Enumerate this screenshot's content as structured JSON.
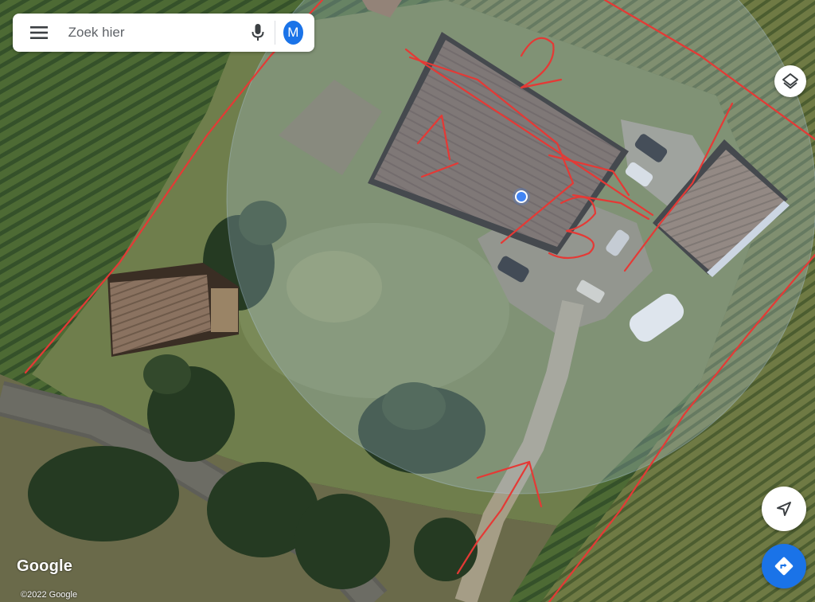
{
  "search": {
    "placeholder": "Zoek hier"
  },
  "account": {
    "initial": "M",
    "color": "#1a73e8"
  },
  "icons": {
    "menu": "menu-icon",
    "mic": "microphone-icon",
    "layers": "layers-icon",
    "compass": "navigation-arrow-icon",
    "directions": "directions-icon"
  },
  "map": {
    "type": "satellite",
    "brand": "Google",
    "copyright": "©2022 Google",
    "annotation_color": "#e53935",
    "location_dot_color": "#4285f4"
  }
}
